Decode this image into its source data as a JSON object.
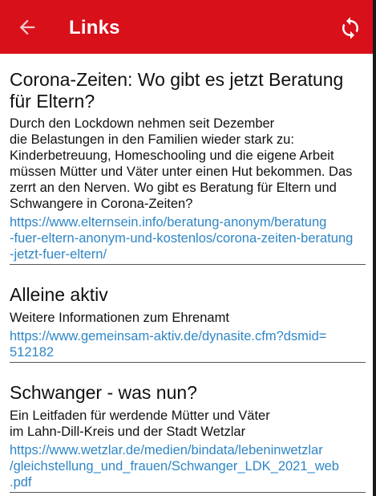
{
  "header": {
    "title": "Links",
    "back_icon": "arrow-left-icon",
    "refresh_icon": "refresh-icon",
    "bar_color": "#d8101a"
  },
  "items": [
    {
      "title": "Corona-Zeiten: Wo gibt es jetzt Beratung\nfür Eltern?",
      "description": "Durch den Lockdown nehmen seit Dezember\ndie Belastungen in den Familien wieder stark zu:\nKinderbetreuung, Homeschooling und die eigene Arbeit\nmüssen Mütter und Väter unter einen Hut bekommen. Das\nzerrt an den Nerven. Wo gibt es Beratung für Eltern und\nSchwangere in Corona-Zeiten?",
      "url": "https://www.elternsein.info/beratung-anonym/beratung\n-fuer-eltern-anonym-und-kostenlos/corona-zeiten-beratung\n-jetzt-fuer-eltern/"
    },
    {
      "title": "Alleine aktiv",
      "description": "Weitere Informationen zum Ehrenamt",
      "url": "https://www.gemeinsam-aktiv.de/dynasite.cfm?dsmid=\n512182"
    },
    {
      "title": "Schwanger - was nun?",
      "description": "Ein Leitfaden für werdende Mütter und Väter\nim Lahn-Dill-Kreis und der Stadt Wetzlar",
      "url": "https://www.wetzlar.de/medien/bindata/lebeninwetzlar\n/gleichstellung_und_frauen/Schwanger_LDK_2021_web\n.pdf"
    }
  ]
}
